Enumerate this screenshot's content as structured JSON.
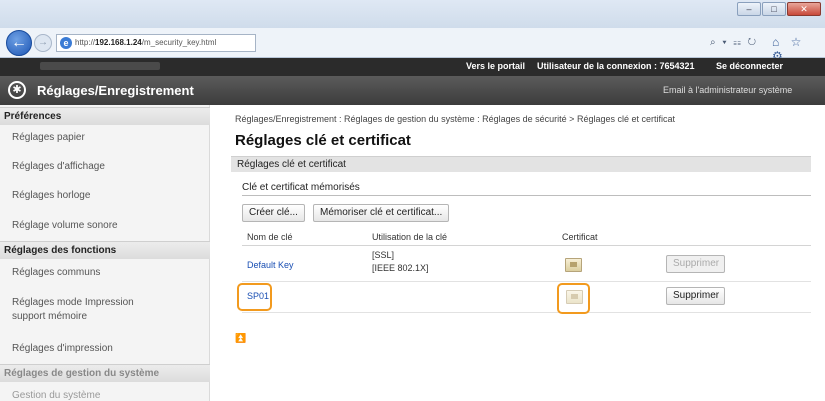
{
  "browser": {
    "url_prefix": "http://",
    "url_host": "192.168.1.24",
    "url_path": "/m_security_key.html",
    "tool_glyphs": "⌕ ▾ ☷ ↻",
    "nav_glyphs": "⌂ ☆ ⚙"
  },
  "topbar": {
    "portal": "Vers le portail",
    "user": "Utilisateur de la connexion :  7654321",
    "logout": "Se déconnecter"
  },
  "header": {
    "title": "Réglages/Enregistrement",
    "mail": "Email à l'administrateur système"
  },
  "sidebar": {
    "groups": [
      "Préférences",
      "Réglages des fonctions",
      "Réglages de gestion du système"
    ],
    "items": [
      "Réglages papier",
      "Réglages d'affichage",
      "Réglages horloge",
      "Réglage volume sonore",
      "Réglages communs",
      "Réglages mode Impression",
      "support mémoire",
      "Réglages d'impression",
      "Gestion du système"
    ]
  },
  "main": {
    "breadcrumb": "Réglages/Enregistrement : Réglages de gestion du système : Réglages de sécurité > Réglages clé et certificat",
    "title": "Réglages clé et certificat",
    "section": "Réglages clé et certificat",
    "subsection": "Clé et certificat mémorisés",
    "create_key": "Créer clé...",
    "save_key": "Mémoriser clé et certificat...",
    "columns": [
      "Nom de clé",
      "Utilisation de la clé",
      "Certificat"
    ],
    "rows": [
      {
        "name": "Default Key",
        "usage1": "[SSL]",
        "usage2": "[IEEE 802.1X]",
        "action": "Supprimer"
      },
      {
        "name": "SP01",
        "usage1": "",
        "usage2": "",
        "action": "Supprimer"
      }
    ]
  },
  "colors": {
    "highlight": "#f29a1e",
    "link": "#1a4fb3"
  }
}
